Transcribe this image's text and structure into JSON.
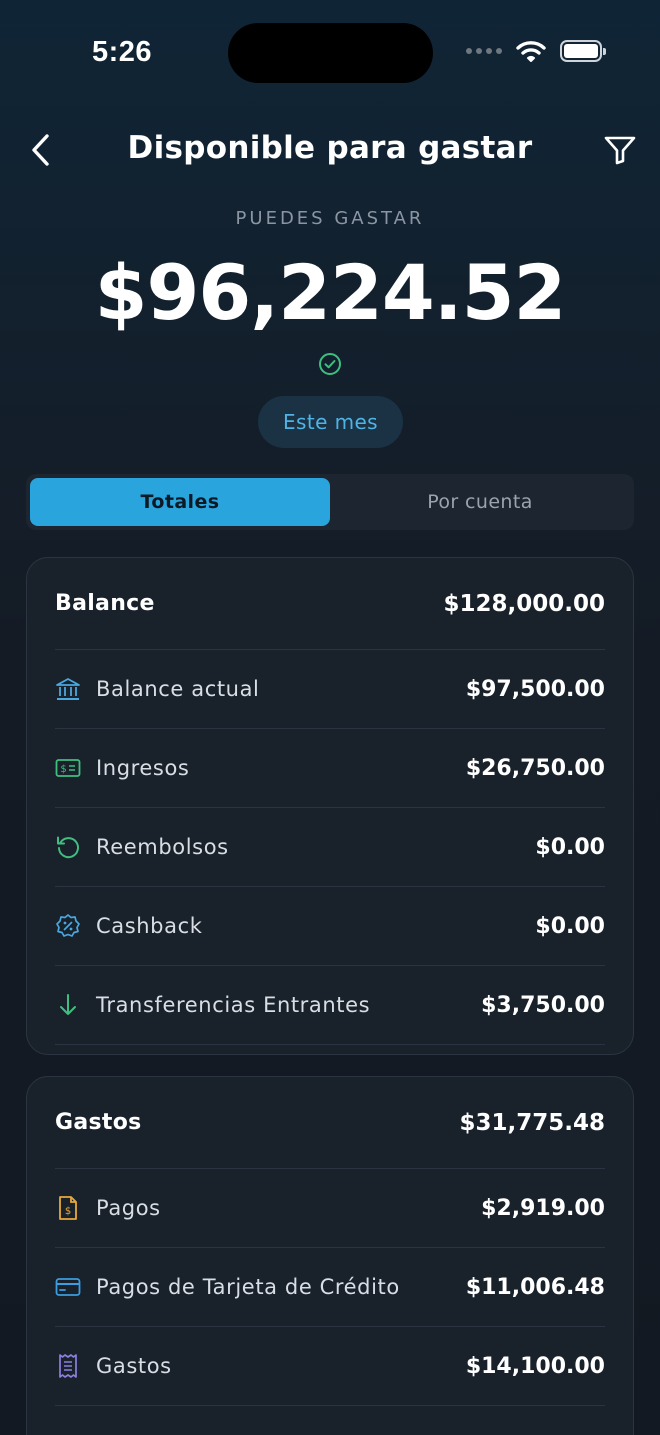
{
  "status": {
    "time": "5:26"
  },
  "header": {
    "title": "Disponible para gastar"
  },
  "summary": {
    "label": "PUEDES GASTAR",
    "amount": "$96,224.52",
    "period": "Este mes"
  },
  "tabs": [
    {
      "label": "Totales",
      "active": true
    },
    {
      "label": "Por cuenta",
      "active": false
    }
  ],
  "balance": {
    "title": "Balance",
    "total": "$128,000.00",
    "rows": [
      {
        "icon": "bank-icon",
        "label": "Balance actual",
        "amount": "$97,500.00"
      },
      {
        "icon": "cash-icon",
        "label": "Ingresos",
        "amount": "$26,750.00"
      },
      {
        "icon": "refund-icon",
        "label": "Reembolsos",
        "amount": "$0.00"
      },
      {
        "icon": "cashback-icon",
        "label": "Cashback",
        "amount": "$0.00"
      },
      {
        "icon": "arrow-down-icon",
        "label": "Transferencias Entrantes",
        "amount": "$3,750.00"
      }
    ]
  },
  "gastos": {
    "title": "Gastos",
    "total": "$31,775.48",
    "rows": [
      {
        "icon": "invoice-icon",
        "label": "Pagos",
        "amount": "$2,919.00"
      },
      {
        "icon": "credit-card-icon",
        "label": "Pagos de Tarjeta de Crédito",
        "amount": "$11,006.48"
      },
      {
        "icon": "receipt-icon",
        "label": "Gastos",
        "amount": "$14,100.00"
      }
    ]
  },
  "colors": {
    "accent": "#2aa4dc",
    "bank": "#4aa8e0",
    "income": "#3fbf7f",
    "refund": "#3fbf7f",
    "cashback": "#4aa8e0",
    "transfer": "#3fbf7f",
    "payments": "#e8a93a",
    "card": "#3a9ee0",
    "expenses": "#8e7fe0"
  }
}
